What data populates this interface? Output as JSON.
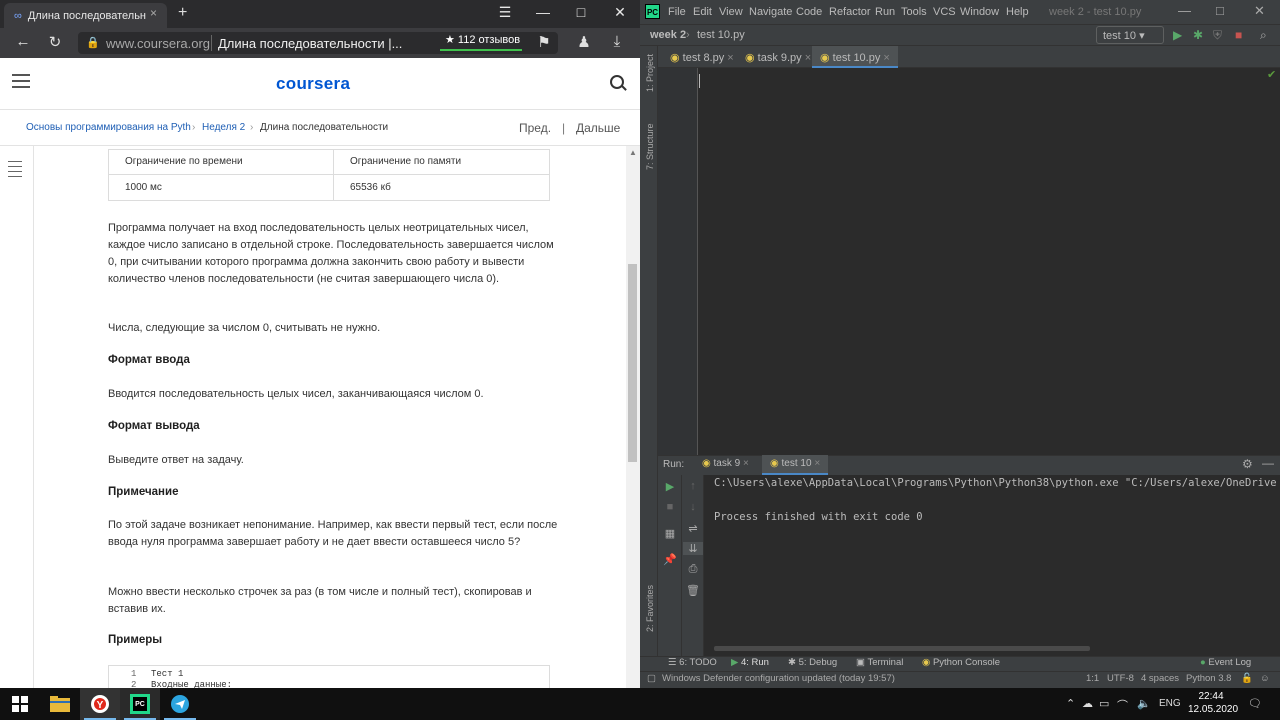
{
  "browser": {
    "tab_title": "Длина последовательн",
    "tab_close": "×",
    "new_tab": "+",
    "window_controls": {
      "menu": "☰",
      "minimize": "—",
      "maximize": "□",
      "close": "✕"
    },
    "domain": "www.coursera.org",
    "page_title": "Длина последовательности |...",
    "reviews": "★ 112 отзывов"
  },
  "coursera": {
    "logo": "coursera",
    "breadcrumb": {
      "course": "Основы программирования на Pyth",
      "week": "Неделя 2",
      "current": "Длина последовательности",
      "sep": "›"
    },
    "prev": "Пред.",
    "divider": "|",
    "next": "Дальше",
    "limits": {
      "time_header": "Ограничение по времени",
      "memory_header": "Ограничение по памяти",
      "time_value": "1000 мс",
      "memory_value": "65536 кб"
    },
    "paragraphs": {
      "p1": "Программа получает на вход последовательность целых неотрицательных чисел, каждое число записано в отдельной строке. Последовательность завершается числом 0, при считывании которого программа должна закончить свою работу и вывести количество членов последовательности (не считая завершающего числа 0).",
      "p2": "Числа, следующие за числом 0, считывать не нужно.",
      "h_input": "Формат ввода",
      "p_input": "Вводится последовательность целых чисел, заканчивающаяся числом 0.",
      "h_output": "Формат вывода",
      "p_output": "Выведите ответ на задачу.",
      "h_note": "Примечание",
      "p_note": "По этой задаче возникает непонимание. Например, как ввести первый тест, если после ввода нуля программа завершает работу и не дает ввести оставшееся число 5?",
      "p_note2": "Можно ввести несколько строчек за раз (в том числе и полный тест), скопировав и вставив их.",
      "h_examples": "Примеры"
    },
    "code": {
      "n1": "1",
      "l1": "Тест 1",
      "n2": "2",
      "l2": "Входные данные:"
    }
  },
  "ide": {
    "menu": [
      "File",
      "Edit",
      "View",
      "Navigate",
      "Code",
      "Refactor",
      "Run",
      "Tools",
      "VCS",
      "Window",
      "Help"
    ],
    "window_title": "week 2 - test 10.py",
    "nav_project": "week 2",
    "nav_arrow": "›",
    "nav_file": "test 10.py",
    "run_config": "test 10 ▾",
    "left_tools": {
      "project": "1: Project",
      "structure": "7: Structure",
      "favorites": "2: Favorites"
    },
    "editor_tabs": [
      "test 8.py",
      "task 9.py",
      "test 10.py"
    ],
    "tab_close": "×",
    "run_label": "Run:",
    "run_tabs": [
      "task 9",
      "test 10"
    ],
    "console": {
      "line1": "C:\\Users\\alexe\\AppData\\Local\\Programs\\Python\\Python38\\python.exe \"C:/Users/alexe/OneDrive",
      "line2": "Process finished with exit code 0"
    },
    "bottom_tools": [
      "6: TODO",
      "4: Run",
      "5: Debug",
      "Terminal",
      "Python Console"
    ],
    "event_log": "Event Log",
    "status": {
      "message": "Windows Defender configuration updated (today 19:57)",
      "position": "1:1",
      "encoding": "UTF-8",
      "indent": "4 spaces",
      "interpreter": "Python 3.8"
    }
  },
  "taskbar": {
    "lang": "ENG",
    "time": "22:44",
    "date": "12.05.2020",
    "ide_icon": "PC"
  },
  "colors": {
    "coursera_blue": "#0056d2",
    "ide_bg": "#2b2b2b",
    "ide_panel": "#3c3f41",
    "run_green": "#59a869"
  }
}
